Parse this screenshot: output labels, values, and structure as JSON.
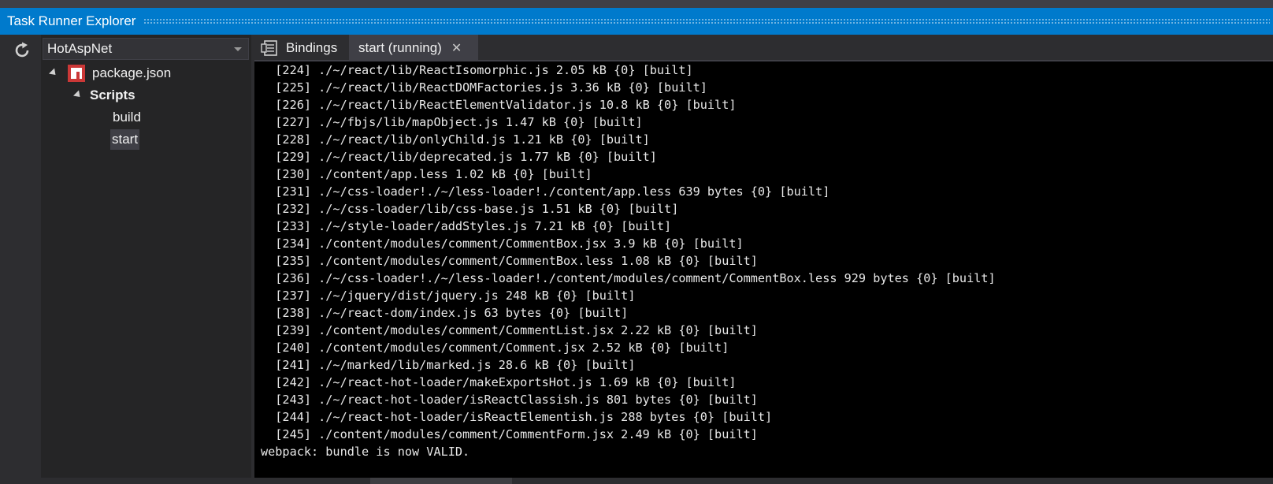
{
  "window": {
    "title": "Task Runner Explorer"
  },
  "toolbar": {
    "refresh_icon": "refresh-icon"
  },
  "project_selector": {
    "value": "HotAspNet",
    "icon": "chevron-down-icon"
  },
  "tree": {
    "root": {
      "label": "package.json",
      "icon": "npm-icon"
    },
    "group": {
      "label": "Scripts"
    },
    "items": [
      {
        "label": "build",
        "selected": false
      },
      {
        "label": "start",
        "selected": true
      }
    ]
  },
  "tabs": [
    {
      "label": "Bindings",
      "icon": "bindings-icon",
      "active": false
    },
    {
      "label": "start (running)",
      "icon": "close-icon",
      "active": true
    }
  ],
  "console": {
    "lines": [
      "  [224] ./~/react/lib/ReactIsomorphic.js 2.05 kB {0} [built]",
      "  [225] ./~/react/lib/ReactDOMFactories.js 3.36 kB {0} [built]",
      "  [226] ./~/react/lib/ReactElementValidator.js 10.8 kB {0} [built]",
      "  [227] ./~/fbjs/lib/mapObject.js 1.47 kB {0} [built]",
      "  [228] ./~/react/lib/onlyChild.js 1.21 kB {0} [built]",
      "  [229] ./~/react/lib/deprecated.js 1.77 kB {0} [built]",
      "  [230] ./content/app.less 1.02 kB {0} [built]",
      "  [231] ./~/css-loader!./~/less-loader!./content/app.less 639 bytes {0} [built]",
      "  [232] ./~/css-loader/lib/css-base.js 1.51 kB {0} [built]",
      "  [233] ./~/style-loader/addStyles.js 7.21 kB {0} [built]",
      "  [234] ./content/modules/comment/CommentBox.jsx 3.9 kB {0} [built]",
      "  [235] ./content/modules/comment/CommentBox.less 1.08 kB {0} [built]",
      "  [236] ./~/css-loader!./~/less-loader!./content/modules/comment/CommentBox.less 929 bytes {0} [built]",
      "  [237] ./~/jquery/dist/jquery.js 248 kB {0} [built]",
      "  [238] ./~/react-dom/index.js 63 bytes {0} [built]",
      "  [239] ./content/modules/comment/CommentList.jsx 2.22 kB {0} [built]",
      "  [240] ./content/modules/comment/Comment.jsx 2.52 kB {0} [built]",
      "  [241] ./~/marked/lib/marked.js 28.6 kB {0} [built]",
      "  [242] ./~/react-hot-loader/makeExportsHot.js 1.69 kB {0} [built]",
      "  [243] ./~/react-hot-loader/isReactClassish.js 801 bytes {0} [built]",
      "  [244] ./~/react-hot-loader/isReactElementish.js 288 bytes {0} [built]",
      "  [245] ./content/modules/comment/CommentForm.jsx 2.49 kB {0} [built]",
      "webpack: bundle is now VALID."
    ]
  },
  "colors": {
    "accent": "#007acc",
    "console_bg": "#000000",
    "npm_red": "#cb3837"
  }
}
